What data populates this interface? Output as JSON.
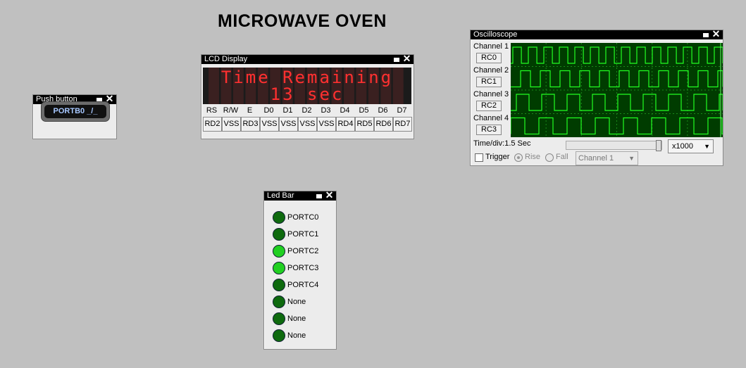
{
  "title": "MICROWAVE OVEN",
  "push_button": {
    "title": "Push button",
    "label": "PORTB0 _/_"
  },
  "lcd": {
    "title": "LCD Display",
    "line1": "Time Remaining",
    "line2": "13 sec",
    "pin_labels": [
      "RS",
      "R/W",
      "E",
      "D0",
      "D1",
      "D2",
      "D3",
      "D4",
      "D5",
      "D6",
      "D7"
    ],
    "pin_values": [
      "RD2",
      "VSS",
      "RD3",
      "VSS",
      "VSS",
      "VSS",
      "VSS",
      "RD4",
      "RD5",
      "RD6",
      "RD7"
    ]
  },
  "led_bar": {
    "title": "Led Bar",
    "leds": [
      {
        "label": "PORTC0",
        "on": false
      },
      {
        "label": "PORTC1",
        "on": false
      },
      {
        "label": "PORTC2",
        "on": true
      },
      {
        "label": "PORTC3",
        "on": true
      },
      {
        "label": "PORTC4",
        "on": false
      },
      {
        "label": "None",
        "on": false
      },
      {
        "label": "None",
        "on": false
      },
      {
        "label": "None",
        "on": false
      }
    ]
  },
  "oscilloscope": {
    "title": "Oscilloscope",
    "channels": [
      {
        "label": "Channel 1",
        "pin": "RC0"
      },
      {
        "label": "Channel 2",
        "pin": "RC1"
      },
      {
        "label": "Channel 3",
        "pin": "RC2"
      },
      {
        "label": "Channel 4",
        "pin": "RC3"
      }
    ],
    "time_div": "Time/div:1.5 Sec",
    "multiplier": "x1000",
    "trigger_label": "Trigger",
    "rise_label": "Rise",
    "fall_label": "Fall",
    "trigger_channel": "Channel 1",
    "colors": {
      "trace": "#22ff22",
      "grid": "#1a8a1a",
      "background": "#003c00"
    }
  }
}
